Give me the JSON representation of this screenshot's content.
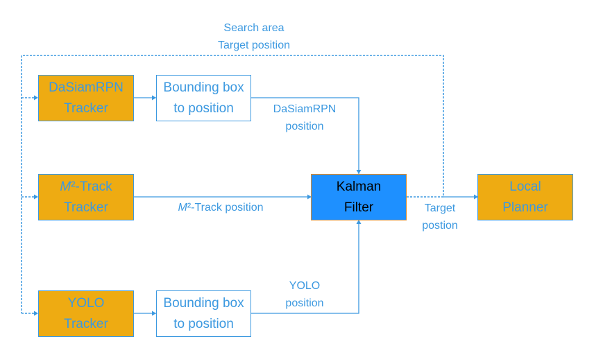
{
  "colors": {
    "line": "#3c99e0",
    "tracker_fill": "#eeab12",
    "filter_fill": "#1e90ff",
    "filter_border": "#d98a2e",
    "text": "#3c99e0"
  },
  "nodes": {
    "dasiam_tracker": {
      "line1": "DaSiamRPN",
      "line2": "Tracker"
    },
    "m2_tracker": {
      "line1_italic": "M",
      "line1_rest": "²-Track",
      "line2": "Tracker"
    },
    "yolo_tracker": {
      "line1": "YOLO",
      "line2": "Tracker"
    },
    "bbox_top": {
      "line1": "Bounding box",
      "line2": "to position"
    },
    "bbox_bottom": {
      "line1": "Bounding box",
      "line2": "to position"
    },
    "kalman": {
      "line1": "Kalman",
      "line2": "Filter"
    },
    "planner": {
      "line1": "Local",
      "line2": "Planner"
    }
  },
  "edge_labels": {
    "feedback": {
      "line1": "Search area",
      "line2": "Target position"
    },
    "dasiam_position": {
      "line1": "DaSiamRPN",
      "line2": "position"
    },
    "m2_position": {
      "italic": "M",
      "rest": "²-Track position"
    },
    "yolo_position": {
      "line1": "YOLO",
      "line2": "position"
    },
    "target_position": {
      "line1": "Target",
      "line2": "postion"
    }
  }
}
